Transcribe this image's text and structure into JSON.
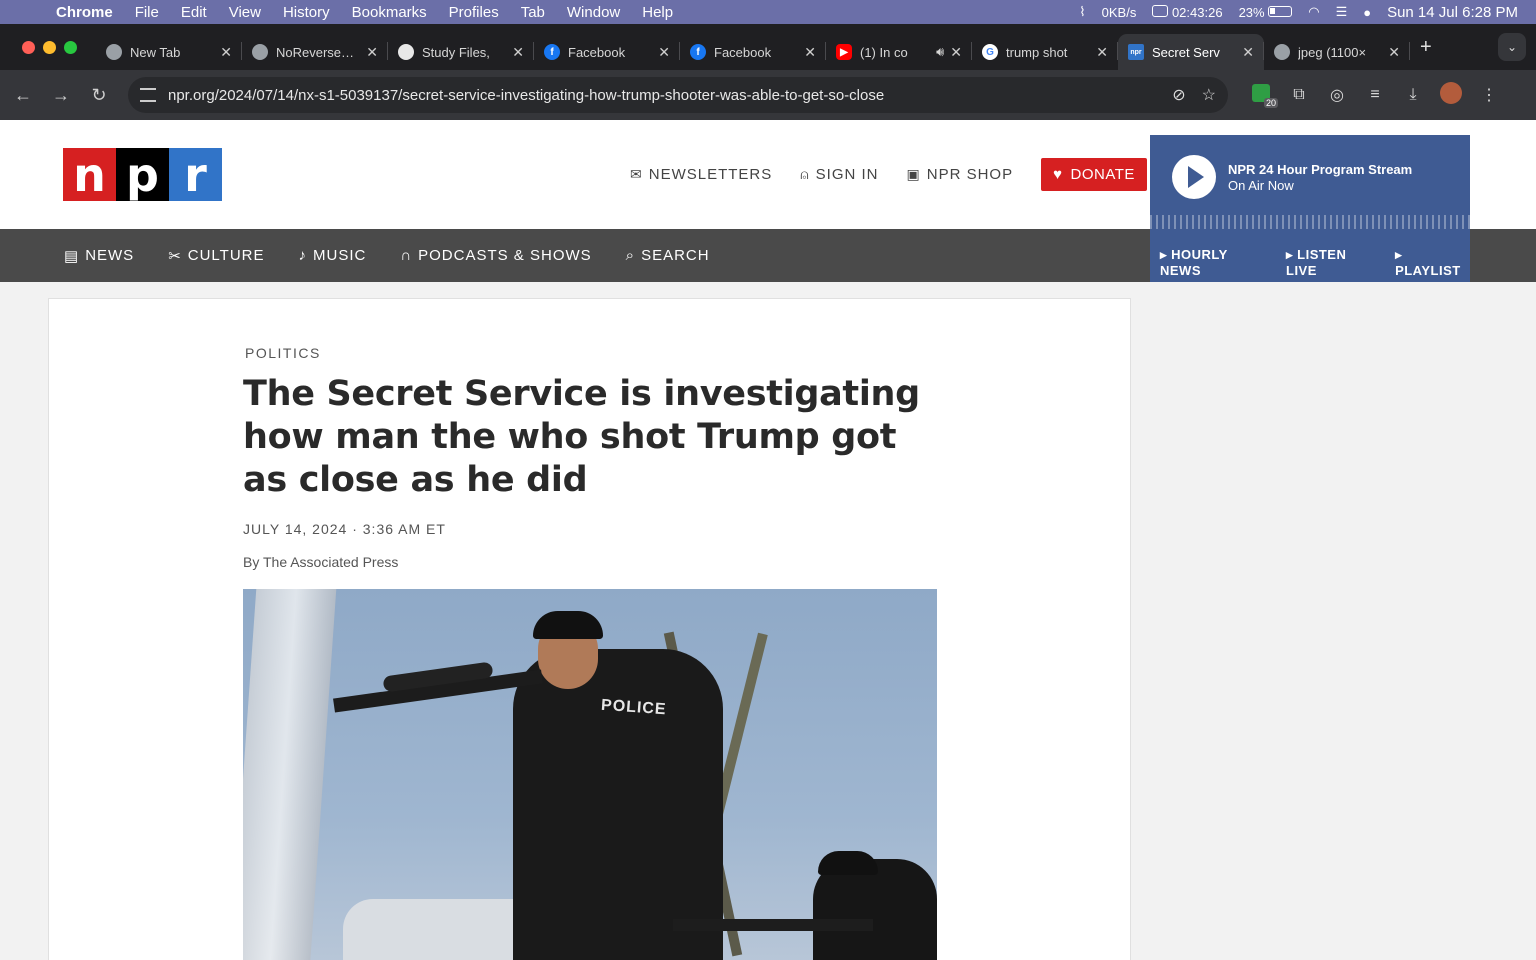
{
  "menubar": {
    "apple": "",
    "app": "Chrome",
    "items": [
      "File",
      "Edit",
      "View",
      "History",
      "Bookmarks",
      "Profiles",
      "Tab",
      "Window",
      "Help"
    ],
    "net_speed": "0KB/s",
    "timer": "02:43:26",
    "battery": "23%",
    "clock": "Sun 14 Jul  6:28 PM"
  },
  "tabs": [
    {
      "title": "New Tab",
      "favicon_color": "#9aa0a6"
    },
    {
      "title": "NoReverse…",
      "favicon_color": "#9aa0a6"
    },
    {
      "title": "Study Files,",
      "favicon_color": "#e8e8e8"
    },
    {
      "title": "Facebook",
      "favicon_color": "#1877f2"
    },
    {
      "title": "Facebook",
      "favicon_color": "#1877f2"
    },
    {
      "title": "(1) In co",
      "favicon_color": "#ff0000"
    },
    {
      "title": "trump shot",
      "favicon_color": "#4285f4"
    },
    {
      "title": "Secret Serv",
      "favicon_color": "#3174c8"
    },
    {
      "title": "jpeg (1100×",
      "favicon_color": "#9aa0a6"
    }
  ],
  "toolbar": {
    "url": "npr.org/2024/07/14/nx-s1-5039137/secret-service-investigating-how-trump-shooter-was-able-to-get-so-close",
    "ext_badge": "20"
  },
  "npr": {
    "logo": {
      "n": "n",
      "p": "p",
      "r": "r"
    },
    "header_links": {
      "newsletters": "NEWSLETTERS",
      "sign_in": "SIGN IN",
      "shop": "NPR SHOP",
      "donate": "DONATE"
    },
    "player": {
      "title": "NPR 24 Hour Program Stream",
      "subtitle": "On Air Now",
      "links": [
        "HOURLY NEWS",
        "LISTEN LIVE",
        "PLAYLIST"
      ]
    },
    "nav": [
      "NEWS",
      "CULTURE",
      "MUSIC",
      "PODCASTS & SHOWS",
      "SEARCH"
    ]
  },
  "article": {
    "kicker": "POLITICS",
    "headline": "The Secret Service is investigating how man the who shot Trump got as close as he did",
    "dateline": "JULY 14, 2024 · 3:36 AM ET",
    "byline": "By The Associated Press",
    "photo_text": "POLICE"
  },
  "colors": {
    "menubar": "#6b6fa8",
    "npr_red": "#d62021",
    "npr_blue": "#3174c8",
    "player_bg": "#3f5b93",
    "nav_bg": "#4a4a4a"
  }
}
